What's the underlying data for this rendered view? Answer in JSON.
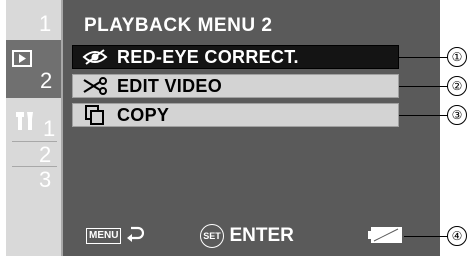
{
  "tabs": {
    "top": [
      {
        "label": "1",
        "active": false
      },
      {
        "label": "2",
        "active": true,
        "icon": "playback-icon"
      }
    ],
    "setup": [
      {
        "label": "1",
        "icon": "setup-tools-icon"
      },
      {
        "label": "2"
      },
      {
        "label": "3"
      }
    ]
  },
  "menu": {
    "title": "PLAYBACK MENU 2",
    "items": [
      {
        "label": "RED-EYE CORRECT.",
        "icon": "red-eye-icon",
        "selected": true
      },
      {
        "label": "EDIT VIDEO",
        "icon": "scissors-icon",
        "selected": false
      },
      {
        "label": "COPY",
        "icon": "copy-icon",
        "selected": false
      }
    ]
  },
  "footer": {
    "menu_label": "MENU",
    "set_label": "SET",
    "enter_label": "ENTER"
  },
  "callouts": [
    "①",
    "②",
    "③",
    "④"
  ],
  "colors": {
    "panel": "#5a5a5a",
    "selected_row": "#141414",
    "normal_row": "#d3d3d3",
    "tab_column": "#d9d9d9",
    "active_tab": "#707070"
  }
}
